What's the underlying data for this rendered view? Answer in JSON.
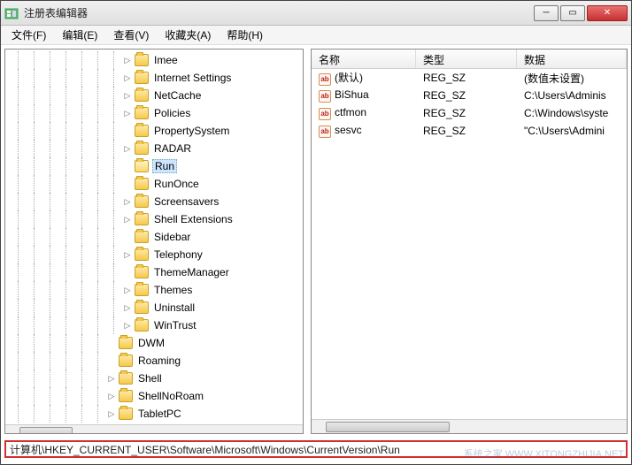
{
  "window": {
    "title": "注册表编辑器"
  },
  "menu": {
    "file": "文件(F)",
    "edit": "编辑(E)",
    "view": "查看(V)",
    "favorites": "收藏夹(A)",
    "help": "帮助(H)"
  },
  "tree": {
    "items": [
      {
        "label": "Imee",
        "depth": 7,
        "expander": "▷"
      },
      {
        "label": "Internet Settings",
        "depth": 7,
        "expander": "▷"
      },
      {
        "label": "NetCache",
        "depth": 7,
        "expander": "▷"
      },
      {
        "label": "Policies",
        "depth": 7,
        "expander": "▷"
      },
      {
        "label": "PropertySystem",
        "depth": 7,
        "expander": ""
      },
      {
        "label": "RADAR",
        "depth": 7,
        "expander": "▷"
      },
      {
        "label": "Run",
        "depth": 7,
        "expander": "",
        "selected": true,
        "open": true
      },
      {
        "label": "RunOnce",
        "depth": 7,
        "expander": ""
      },
      {
        "label": "Screensavers",
        "depth": 7,
        "expander": "▷"
      },
      {
        "label": "Shell Extensions",
        "depth": 7,
        "expander": "▷"
      },
      {
        "label": "Sidebar",
        "depth": 7,
        "expander": ""
      },
      {
        "label": "Telephony",
        "depth": 7,
        "expander": "▷"
      },
      {
        "label": "ThemeManager",
        "depth": 7,
        "expander": ""
      },
      {
        "label": "Themes",
        "depth": 7,
        "expander": "▷"
      },
      {
        "label": "Uninstall",
        "depth": 7,
        "expander": "▷"
      },
      {
        "label": "WinTrust",
        "depth": 7,
        "expander": "▷"
      },
      {
        "label": "DWM",
        "depth": 6,
        "expander": ""
      },
      {
        "label": "Roaming",
        "depth": 6,
        "expander": ""
      },
      {
        "label": "Shell",
        "depth": 6,
        "expander": "▷"
      },
      {
        "label": "ShellNoRoam",
        "depth": 6,
        "expander": "▷"
      },
      {
        "label": "TabletPC",
        "depth": 6,
        "expander": "▷"
      }
    ]
  },
  "list": {
    "columns": {
      "name": "名称",
      "type": "类型",
      "data": "数据"
    },
    "rows": [
      {
        "name": "(默认)",
        "type": "REG_SZ",
        "data": "(数值未设置)"
      },
      {
        "name": "BiShua",
        "type": "REG_SZ",
        "data": "C:\\Users\\Adminis"
      },
      {
        "name": "ctfmon",
        "type": "REG_SZ",
        "data": "C:\\Windows\\syste"
      },
      {
        "name": "sesvc",
        "type": "REG_SZ",
        "data": "\"C:\\Users\\Admini"
      }
    ]
  },
  "statusbar": {
    "path": "计算机\\HKEY_CURRENT_USER\\Software\\Microsoft\\Windows\\CurrentVersion\\Run"
  },
  "watermark": "系统之家 WWW.XITONGZHIJIA.NET"
}
